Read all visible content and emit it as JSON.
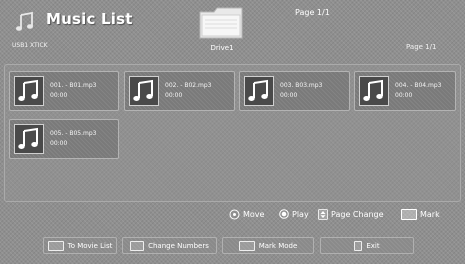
{
  "header": {
    "title": "Music List",
    "usage": "USB1 XTICK",
    "folder_label": "Drive1",
    "page_top": "Page 1/1",
    "page_right": "Page 1/1"
  },
  "files": [
    {
      "name": "001. - B01.mp3",
      "time": "00:00"
    },
    {
      "name": "002. - B02.mp3",
      "time": "00:00"
    },
    {
      "name": "003. B03.mp3",
      "time": "00:00"
    },
    {
      "name": "004. - B04.mp3",
      "time": "00:00"
    },
    {
      "name": "005. - B05.mp3",
      "time": "00:00"
    }
  ],
  "hints": {
    "move": "Move",
    "play": "Play",
    "page_change": "Page Change",
    "mark": "Mark"
  },
  "buttons": {
    "movie_list": "To Movie List",
    "change_numbers": "Change Numbers",
    "mark_mode": "Mark Mode",
    "exit": "Exit"
  },
  "icons": {
    "title": "music-notes-icon",
    "folder": "folder-icon",
    "file": "music-file-icon"
  }
}
